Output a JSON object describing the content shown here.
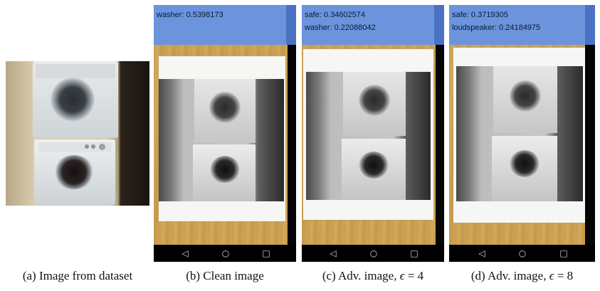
{
  "panels": [
    {
      "caption_prefix": "(a) Image from dataset"
    },
    {
      "caption_prefix": "(b) Clean image",
      "scores": [
        "washer: 0.5398173"
      ]
    },
    {
      "caption_prefix": "(c) Adv. image,",
      "epsilon_symbol": "ϵ",
      "epsilon_value": "= 4",
      "scores": [
        "safe: 0.34602574",
        "washer: 0.22088042"
      ]
    },
    {
      "caption_prefix": "(d) Adv. image,",
      "epsilon_symbol": "ϵ",
      "epsilon_value": "= 8",
      "scores": [
        "safe: 0.3719305",
        "loudspeaker: 0.24184975"
      ]
    }
  ],
  "nav_icons": [
    "back-icon",
    "home-icon",
    "recents-icon"
  ],
  "colors": {
    "status_bar": "#6b94dd",
    "status_bar_edge": "#4a72c4",
    "wood": "#c89d4e",
    "nav_bar": "#000000"
  }
}
